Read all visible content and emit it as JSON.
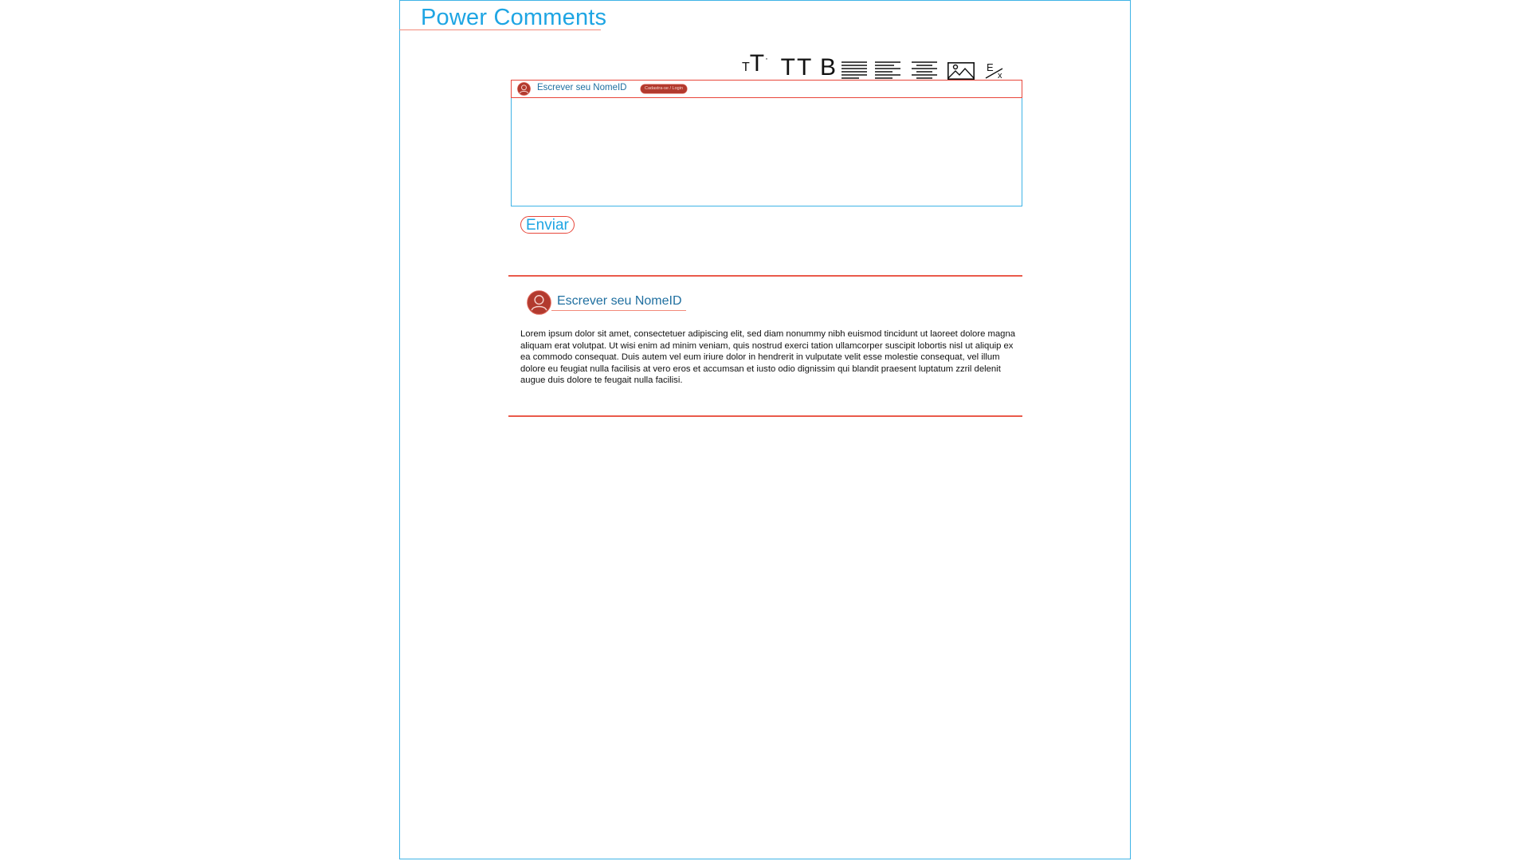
{
  "app": {
    "title": "Power Comments"
  },
  "colors": {
    "accent_blue": "#1ea5e3",
    "frame_blue": "#3fb3e6",
    "accent_red": "#e8463a",
    "avatar_red": "#b23a2e",
    "name_blue": "#1f6fa0"
  },
  "toolbar": {
    "items": [
      {
        "name": "font-size",
        "icon": "font-size-icon",
        "label_small": "T",
        "label_large": "T",
        "suffix": "▾"
      },
      {
        "name": "uppercase",
        "icon": "uppercase-icon",
        "label": "TT"
      },
      {
        "name": "bold",
        "icon": "bold-icon",
        "label": "B"
      },
      {
        "name": "justify",
        "icon": "align-justify-icon"
      },
      {
        "name": "align-left",
        "icon": "align-left-icon"
      },
      {
        "name": "align-center",
        "icon": "align-center-icon"
      },
      {
        "name": "insert-image",
        "icon": "image-icon"
      },
      {
        "name": "clear-format",
        "icon": "clear-format-icon"
      }
    ]
  },
  "composer": {
    "name_placeholder": "Escrever seu NomeID",
    "login_label": "Cadastra-se / Login",
    "textarea_value": "",
    "send_label": "Enviar"
  },
  "comments": [
    {
      "author": "Escrever seu NomeID",
      "avatar_icon": "user-avatar-icon",
      "body": "Lorem ipsum dolor sit amet, consectetuer adipiscing elit, sed diam nonummy nibh euismod tincidunt ut laoreet dolore magna aliquam erat volutpat. Ut wisi enim ad minim veniam, quis nostrud exerci tation ullamcorper suscipit lobortis nisl ut aliquip ex ea commodo consequat. Duis autem vel eum iriure dolor in hendrerit in vulputate velit esse molestie consequat, vel illum dolore eu feugiat nulla facilisis at vero eros et accumsan et iusto odio dignissim qui blandit praesent luptatum zzril delenit augue duis dolore te feugait nulla facilisi."
    }
  ]
}
